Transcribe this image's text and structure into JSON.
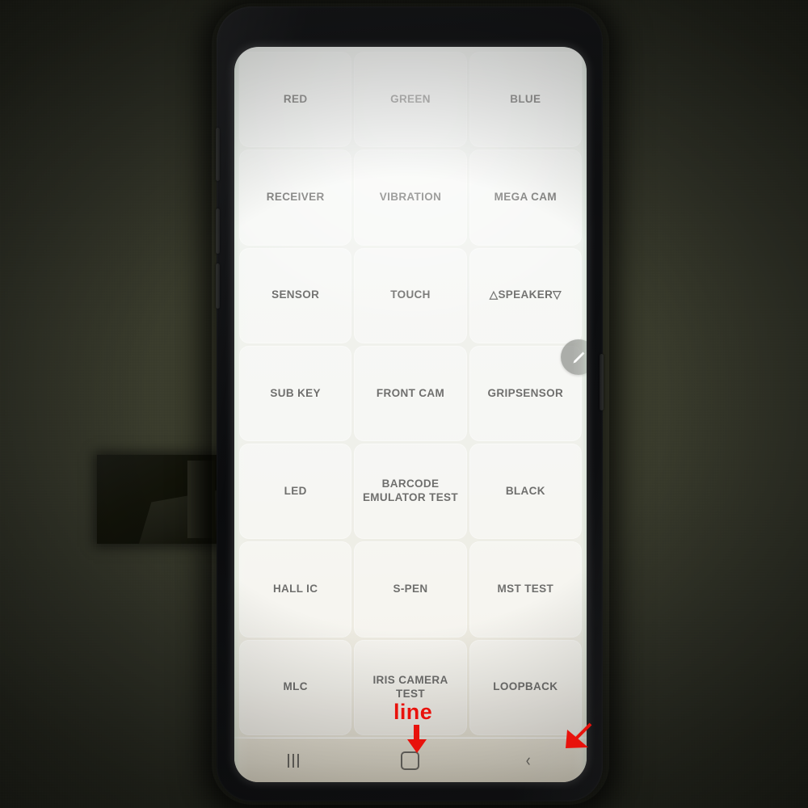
{
  "scene": {
    "description": "Samsung Galaxy Note phone running the hidden hardware test menu, photographed on a dark olive surface",
    "background_color": "#34372b",
    "phone_frame_color": "#0d0e10"
  },
  "screen": {
    "background_color": "#eff1eb",
    "tile_text_color": "#6f6f6d",
    "grid": {
      "columns": 3,
      "rows": 7,
      "tiles": [
        {
          "label": "RED"
        },
        {
          "label": "GREEN"
        },
        {
          "label": "BLUE"
        },
        {
          "label": "RECEIVER"
        },
        {
          "label": "VIBRATION"
        },
        {
          "label": "MEGA CAM"
        },
        {
          "label": "SENSOR"
        },
        {
          "label": "TOUCH"
        },
        {
          "label": "△SPEAKER▽"
        },
        {
          "label": "SUB KEY"
        },
        {
          "label": "FRONT CAM"
        },
        {
          "label": "GRIPSENSOR"
        },
        {
          "label": "LED"
        },
        {
          "label": "BARCODE EMULATOR TEST"
        },
        {
          "label": "BLACK"
        },
        {
          "label": "HALL IC"
        },
        {
          "label": "S-PEN"
        },
        {
          "label": "MST TEST"
        },
        {
          "label": "MLC"
        },
        {
          "label": "IRIS CAMERA TEST"
        },
        {
          "label": "LOOPBACK"
        }
      ]
    },
    "edge_handle": {
      "icon": "pen-icon",
      "color": "#96988f"
    },
    "navbar": {
      "background_color": "#e4dfd0",
      "icon_color": "#6e6c66",
      "buttons": [
        {
          "name": "recents",
          "icon": "recents-icon"
        },
        {
          "name": "home",
          "icon": "home-icon"
        },
        {
          "name": "back",
          "icon": "back-icon",
          "glyph": "‹"
        }
      ]
    },
    "defect": {
      "type": "horizontal-line",
      "color": "#ffffff"
    }
  },
  "annotations": {
    "color": "#e8120c",
    "line_label": "line",
    "arrows": [
      {
        "name": "down-arrow",
        "direction": "down"
      },
      {
        "name": "corner-arrow",
        "direction": "down-right"
      }
    ]
  }
}
